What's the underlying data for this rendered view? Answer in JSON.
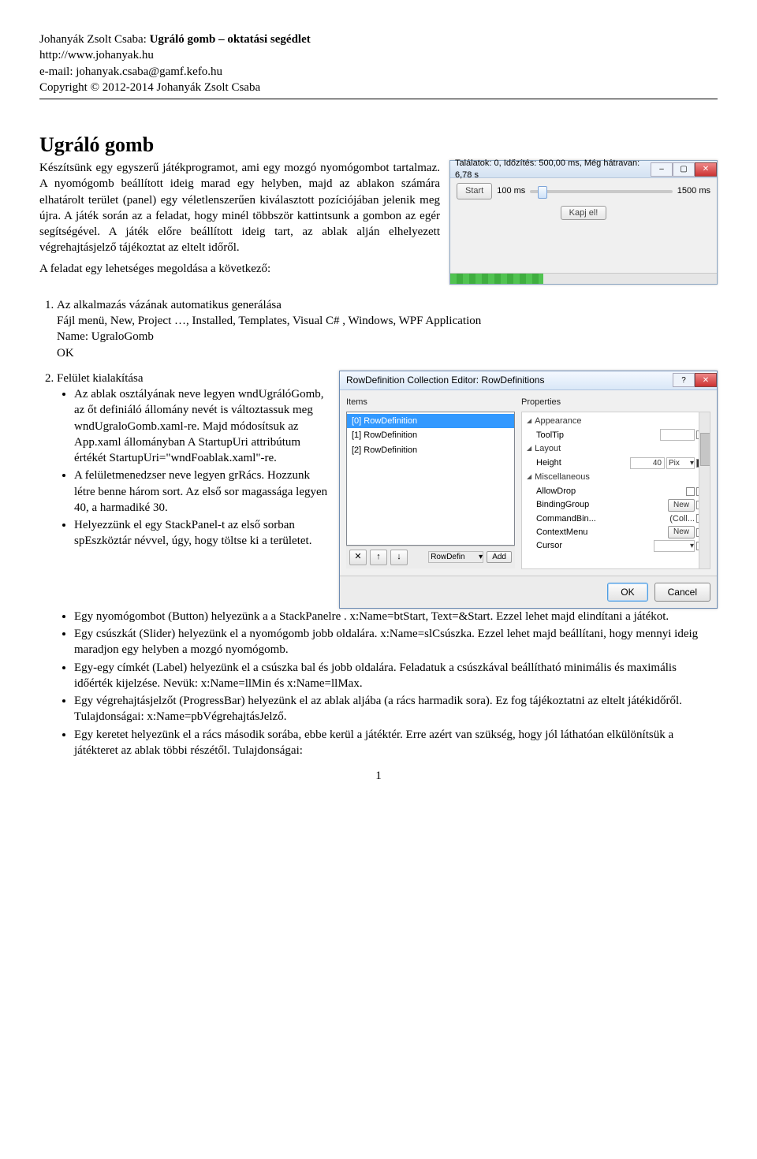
{
  "header": {
    "author_title": "Johanyák Zsolt Csaba: Ugráló gomb – oktatási segédlet",
    "url": "http://www.johanyak.hu",
    "email": "e-mail: johanyak.csaba@gamf.kefo.hu",
    "copyright": "Copyright © 2012-2014 Johanyák Zsolt Csaba"
  },
  "title": "Ugráló gomb",
  "intro_p1": "Készítsünk egy egyszerű játékprogramot, ami egy mozgó nyomógombot tartalmaz. A nyomógomb beállított ideig marad egy helyben, majd az ablakon számára elhatárolt terület (panel) egy véletlenszerűen kiválasztott pozíciójában jelenik meg újra. A játék során az a feladat, hogy minél többször kattintsunk a gombon az egér segítségével. A játék előre beállított ideig tart, az ablak alján elhelyezett végrehajtásjelző tájékoztat az eltelt időről.",
  "intro_p2": "A feladat egy lehetséges megoldása a következő:",
  "win1": {
    "title": "Találatok: 0,  Időzítés:  500,00 ms,  Még hátravan:  6,78 s",
    "start": "Start",
    "lbl_min": "100 ms",
    "lbl_max": "1500 ms",
    "kapj": "Kapj el!"
  },
  "list1": {
    "line1": "Az alkalmazás vázának automatikus generálása",
    "line2": "Fájl menü, New, Project …, Installed, Templates, Visual C# , Windows, WPF Application",
    "line3": "Name: UgraloGomb",
    "line4": "OK"
  },
  "list2_title": "Felület kialakítása",
  "list2": {
    "b1": "Az ablak osztályának neve legyen wndUgrálóGomb, az őt definiáló állomány nevét is változtassuk meg wndUgraloGomb.xaml-re. Majd módosítsuk az App.xaml állományban A StartupUri attribútum értékét StartupUri=\"wndFoablak.xaml\"-re.",
    "b2": "A felületmenedzser neve legyen grRács. Hozzunk létre benne három sort. Az első sor magassága legyen 40, a harmadiké 30.",
    "b3": "Helyezzünk el egy StackPanel-t az első sorban spEszköztár névvel, úgy, hogy töltse ki a területet.",
    "b4": "Egy nyomógombot (Button) helyezünk a a StackPanelre . x:Name=btStart, Text=&Start. Ezzel lehet majd elindítani a játékot.",
    "b5": "Egy csúszkát (Slider) helyezünk el a nyomógomb jobb oldalára. x:Name=slCsúszka. Ezzel lehet majd beállítani, hogy mennyi ideig maradjon egy helyben a mozgó nyomógomb.",
    "b6": "Egy-egy címkét (Label) helyezünk el a csúszka bal és jobb oldalára. Feladatuk a csúszkával beállítható minimális és maximális időérték kijelzése. Nevük: x:Name=llMin és x:Name=llMax.",
    "b7": "Egy végrehajtásjelzőt (ProgressBar) helyezünk el az ablak aljába (a rács harmadik sora). Ez fog tájékoztatni az eltelt játékidőről. Tulajdonságai: x:Name=pbVégrehajtásJelző.",
    "b8": "Egy keretet helyezünk el a rács második sorába, ebbe kerül a játéktér. Erre azért van szükség, hogy jól láthatóan elkülönítsük a játékteret az ablak többi részétől. Tulajdonságai:"
  },
  "win2": {
    "title": "RowDefinition Collection Editor: RowDefinitions",
    "items_header": "Items",
    "props_header": "Properties",
    "items": [
      "[0] RowDefinition",
      "[1] RowDefinition",
      "[2] RowDefinition"
    ],
    "grp_appearance": "Appearance",
    "tooltip": "ToolTip",
    "grp_layout": "Layout",
    "height": "Height",
    "height_val": "40",
    "height_unit": "Pix",
    "grp_misc": "Miscellaneous",
    "allowdrop": "AllowDrop",
    "bindinggroup": "BindingGroup",
    "commandbin": "CommandBin...",
    "commandbin_val": "(Coll...",
    "contextmenu": "ContextMenu",
    "cursor": "Cursor",
    "new": "New",
    "delete_icon": "✕",
    "up_icon": "↑",
    "down_icon": "↓",
    "combo_text": "RowDefin",
    "add": "Add",
    "ok": "OK",
    "cancel": "Cancel"
  },
  "page_number": "1"
}
